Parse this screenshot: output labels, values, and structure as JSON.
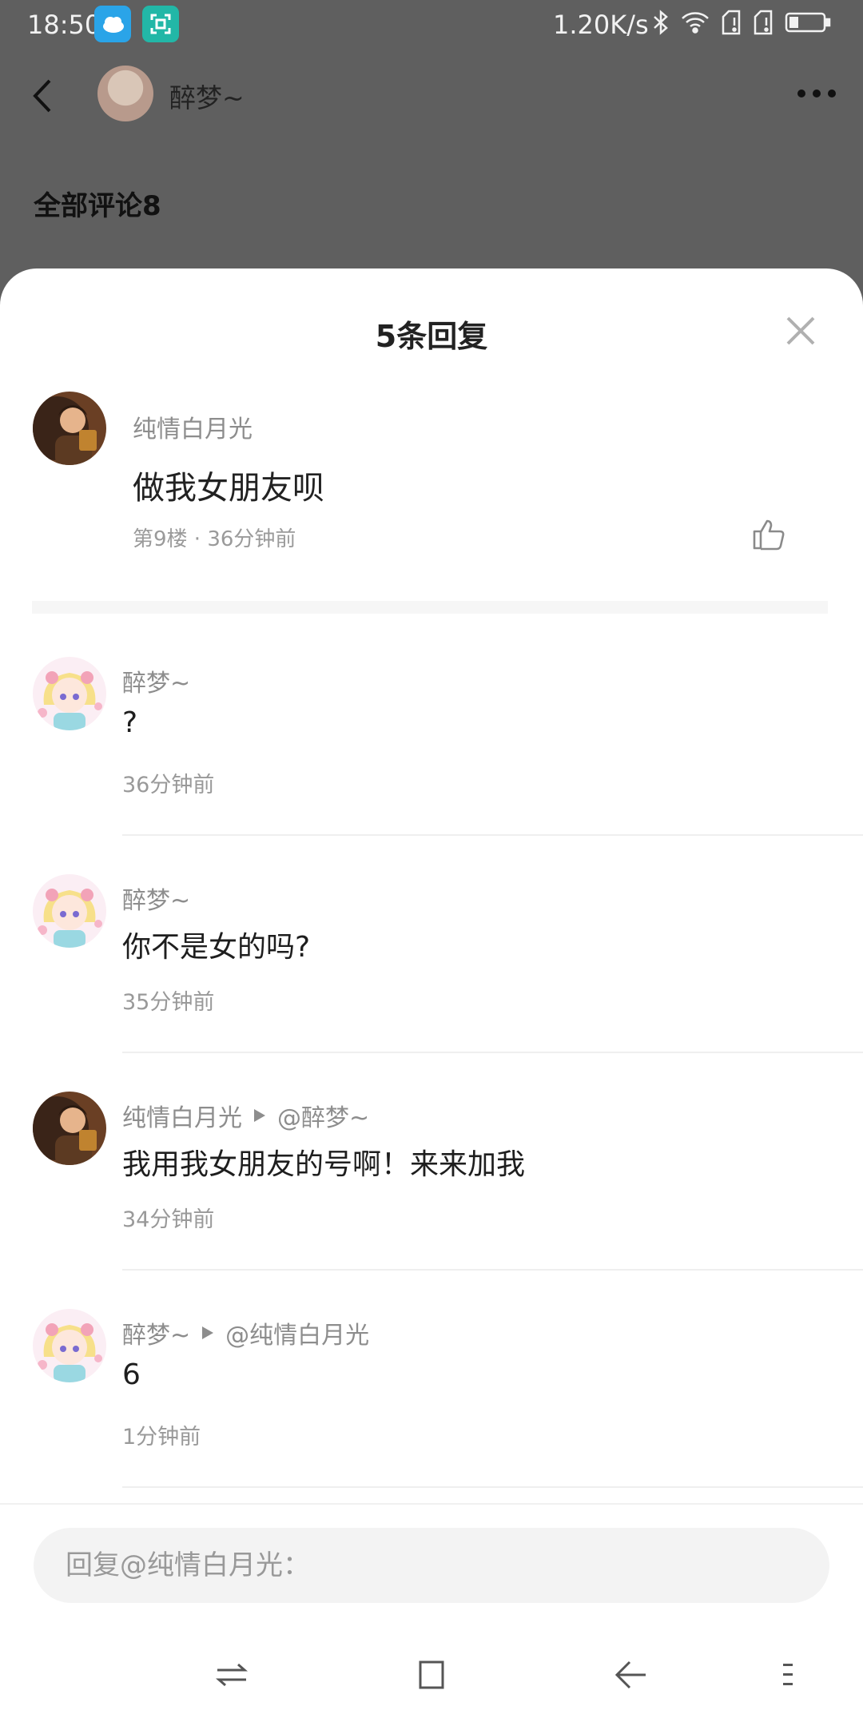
{
  "status_bar": {
    "time": "18:50",
    "net_speed": "1.20K/s",
    "icons": [
      "weather-icon",
      "scan-icon",
      "bluetooth-icon",
      "wifi-icon",
      "sim-icon",
      "sim-icon",
      "battery-icon"
    ]
  },
  "background_page": {
    "username": "醉梦~",
    "all_comments": "全部评论8"
  },
  "sheet": {
    "title": "5条回复",
    "main_comment": {
      "user": "纯情白月光",
      "text": "做我女朋友呗",
      "meta": "第9楼 · 36分钟前"
    },
    "replies": [
      {
        "user": "醉梦~",
        "to": "",
        "text": "?",
        "time": "36分钟前",
        "avatar": "girl"
      },
      {
        "user": "醉梦~",
        "to": "",
        "text": "你不是女的吗?",
        "time": "35分钟前",
        "avatar": "girl"
      },
      {
        "user": "纯情白月光",
        "to": "@醉梦~",
        "text": "我用我女朋友的号啊！来来加我",
        "time": "34分钟前",
        "avatar": "boy"
      },
      {
        "user": "醉梦~",
        "to": "@纯情白月光",
        "text": "6",
        "time": "1分钟前",
        "avatar": "girl"
      }
    ],
    "input_placeholder": "回复@纯情白月光："
  },
  "colors": {
    "accent_text": "#222222",
    "muted_text": "#8d8d8d",
    "overlay": "#5f5f5f"
  }
}
